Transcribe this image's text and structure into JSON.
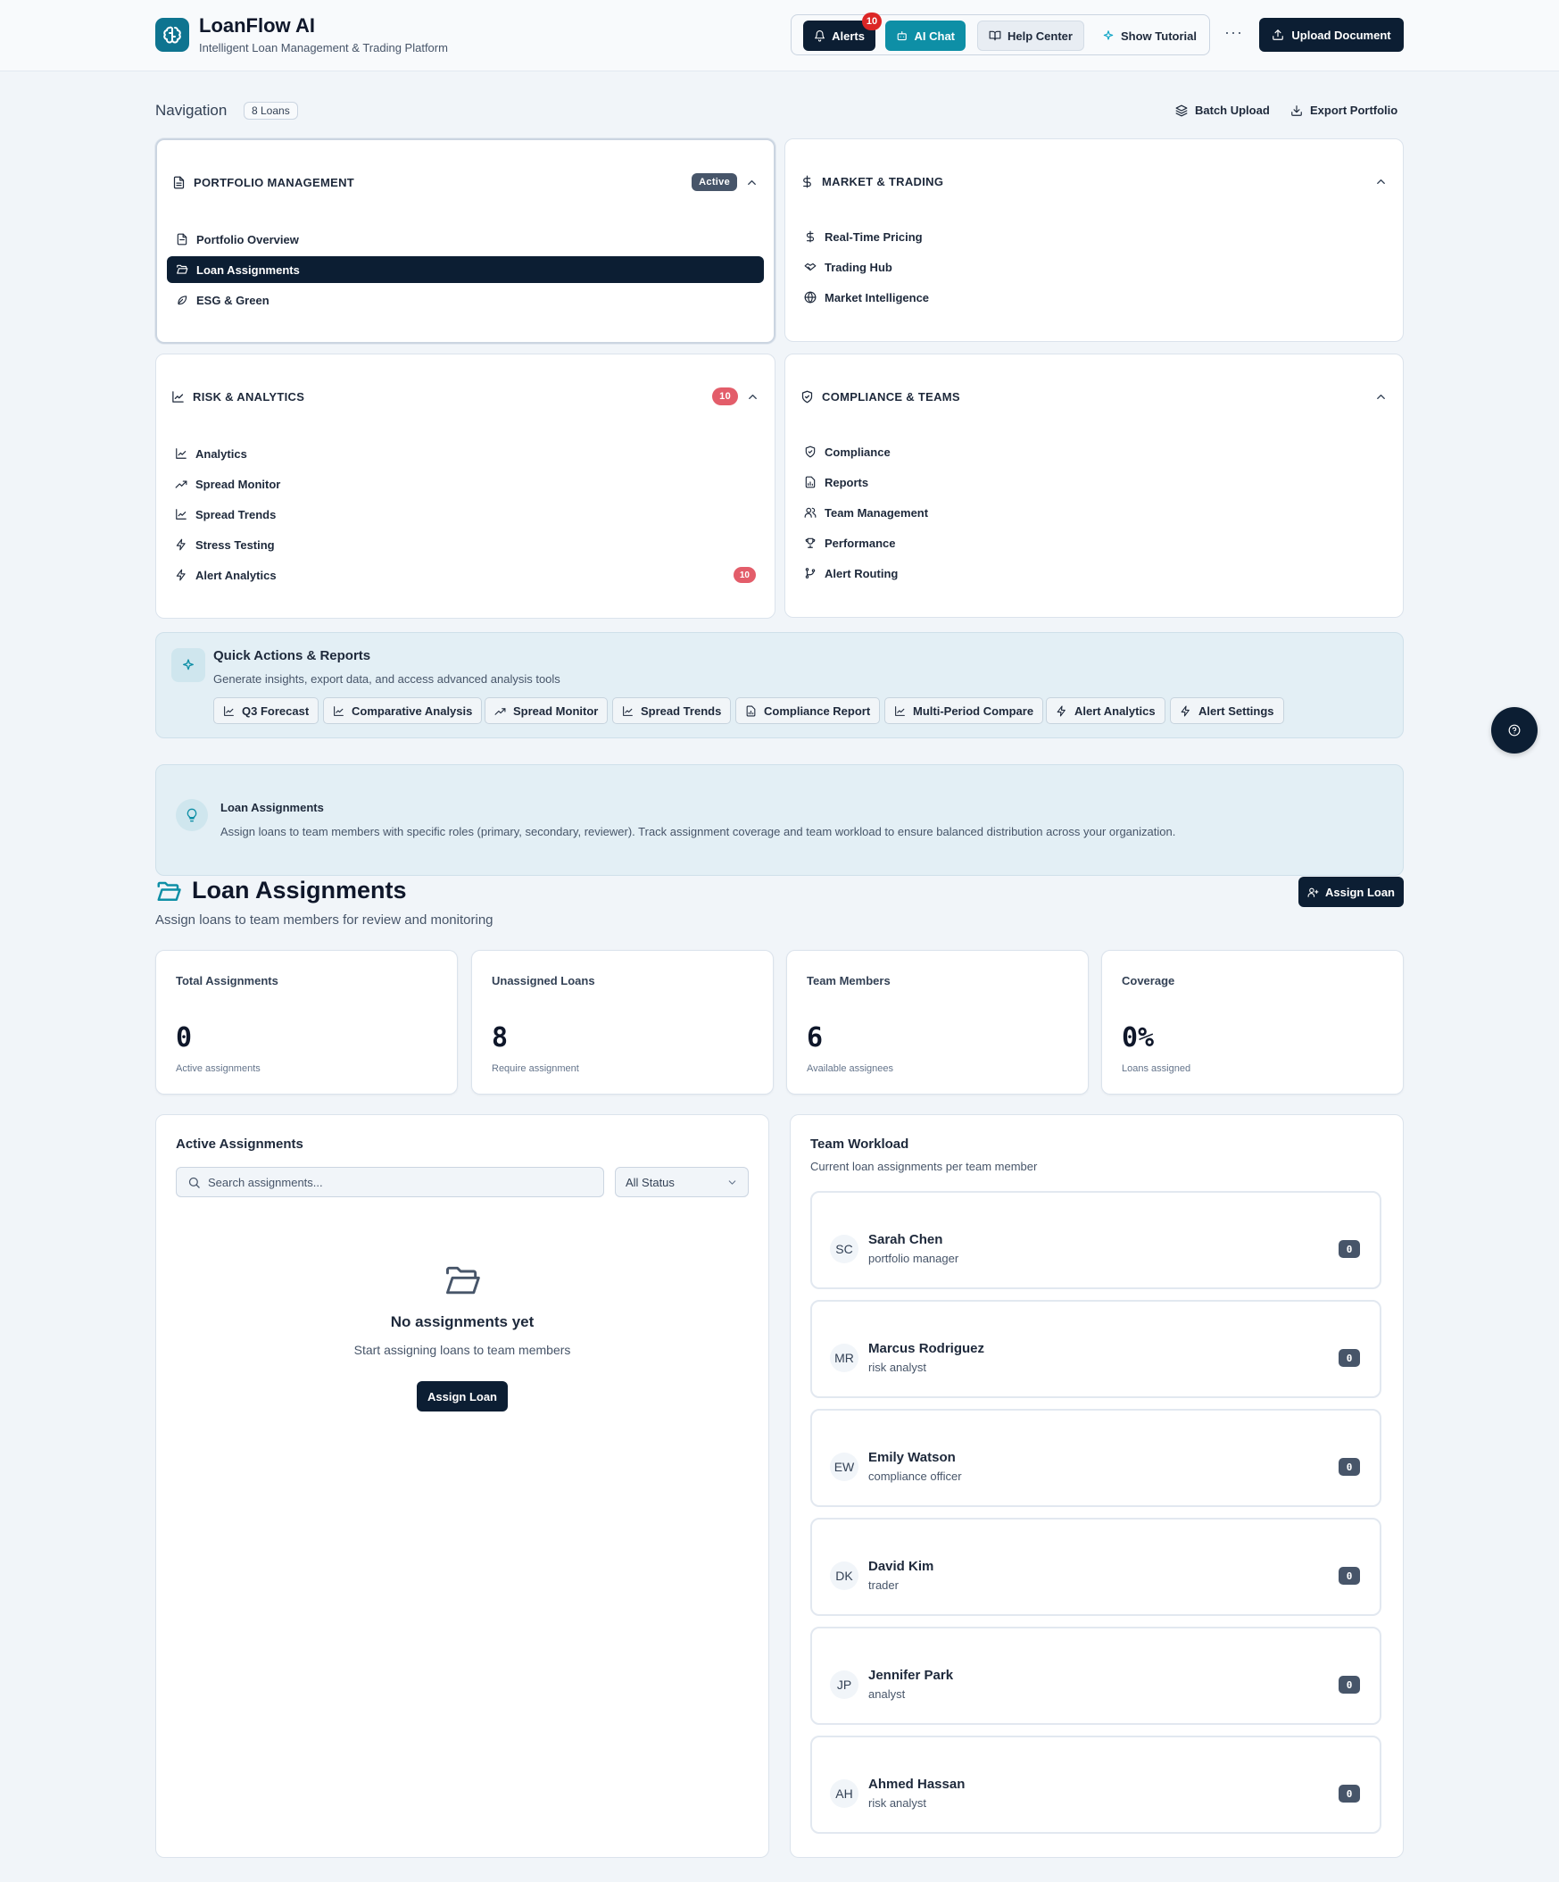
{
  "app": {
    "title": "LoanFlow AI",
    "subtitle": "Intelligent Loan Management & Trading Platform",
    "logo_icon": "brain-icon"
  },
  "header": {
    "alerts_label": "Alerts",
    "alerts_badge": "10",
    "ai_chat_label": "AI Chat",
    "help_center_label": "Help Center",
    "tutorial_label": "Show Tutorial",
    "more_label": "···",
    "upload_label": "Upload Document"
  },
  "navigation": {
    "title": "Navigation",
    "loan_count": "8 Loans",
    "batch_upload": "Batch Upload",
    "export_portfolio": "Export Portfolio",
    "sections": [
      {
        "title": "PORTFOLIO MANAGEMENT",
        "badge": "Active",
        "items": [
          "Portfolio Overview",
          "Loan Assignments",
          "ESG & Green"
        ],
        "selected": "Loan Assignments"
      },
      {
        "title": "MARKET & TRADING",
        "items": [
          "Real-Time Pricing",
          "Trading Hub",
          "Market Intelligence"
        ]
      },
      {
        "title": "RISK & ANALYTICS",
        "badge": "10",
        "items": [
          "Analytics",
          "Spread Monitor",
          "Spread Trends",
          "Stress Testing",
          "Alert Analytics"
        ],
        "item_badge": "10"
      },
      {
        "title": "COMPLIANCE & TEAMS",
        "items": [
          "Compliance",
          "Reports",
          "Team Management",
          "Performance",
          "Alert Routing"
        ]
      }
    ]
  },
  "quick_actions": {
    "title": "Quick Actions & Reports",
    "subtitle": "Generate insights, export data, and access advanced analysis tools",
    "buttons": [
      "Q3 Forecast",
      "Comparative Analysis",
      "Spread Monitor",
      "Spread Trends",
      "Compliance Report",
      "Multi-Period Compare",
      "Alert Analytics",
      "Alert Settings"
    ]
  },
  "info_banner": {
    "title": "Loan Assignments",
    "text": "Assign loans to team members with specific roles (primary, secondary, reviewer). Track assignment coverage and team workload to ensure balanced distribution across your organization."
  },
  "page": {
    "title": "Loan Assignments",
    "subtitle": "Assign loans to team members for review and monitoring",
    "assign_button": "Assign Loan"
  },
  "stats": [
    {
      "label": "Total Assignments",
      "value": "0",
      "note": "Active assignments"
    },
    {
      "label": "Unassigned Loans",
      "value": "8",
      "note": "Require assignment"
    },
    {
      "label": "Team Members",
      "value": "6",
      "note": "Available assignees"
    },
    {
      "label": "Coverage",
      "value": "0%",
      "note": "Loans assigned"
    }
  ],
  "active_assignments": {
    "title": "Active Assignments",
    "search_placeholder": "Search assignments...",
    "status_filter": "All Status",
    "empty_title": "No assignments yet",
    "empty_subtitle": "Start assigning loans to team members",
    "empty_button": "Assign Loan"
  },
  "team_workload": {
    "title": "Team Workload",
    "subtitle": "Current loan assignments per team member",
    "members": [
      {
        "initials": "SC",
        "name": "Sarah Chen",
        "role": "portfolio manager",
        "count": "0"
      },
      {
        "initials": "MR",
        "name": "Marcus Rodriguez",
        "role": "risk analyst",
        "count": "0"
      },
      {
        "initials": "EW",
        "name": "Emily Watson",
        "role": "compliance officer",
        "count": "0"
      },
      {
        "initials": "DK",
        "name": "David Kim",
        "role": "trader",
        "count": "0"
      },
      {
        "initials": "JP",
        "name": "Jennifer Park",
        "role": "analyst",
        "count": "0"
      },
      {
        "initials": "AH",
        "name": "Ahmed Hassan",
        "role": "risk analyst",
        "count": "0"
      }
    ]
  },
  "colors": {
    "primary_dark": "#0c1e33",
    "accent_teal": "#0e8fa6",
    "alert_red": "#dc2626",
    "badge_red": "#e35d6a",
    "page_bg": "#f1f5f9"
  }
}
